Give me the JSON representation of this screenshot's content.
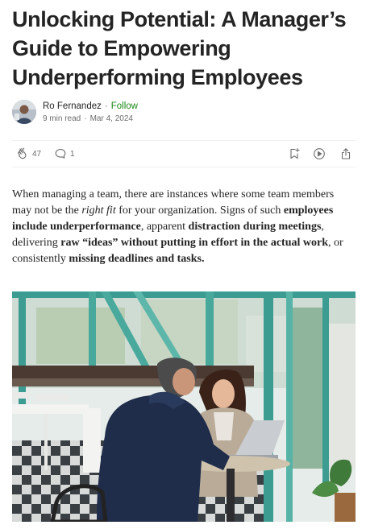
{
  "article": {
    "title": "Unlocking Potential: A Manager’s Guide to Empowering Underperforming Employees"
  },
  "byline": {
    "author": "Ro Fernandez",
    "separator": "·",
    "follow_label": "Follow",
    "read_time": "9 min read",
    "date": "Mar 4, 2024"
  },
  "actions": {
    "claps": "47",
    "responses": "1"
  },
  "body": {
    "p1": "When managing a team, there are instances where some team members may not be the ",
    "p2": "right fit",
    "p3": " for your organization. Signs of such ",
    "p4": "employees include underperformance",
    "p5": ", apparent ",
    "p6": "distraction during meetings",
    "p7": ", delivering ",
    "p8": "raw “ideas” without putting in effort in the actual work",
    "p9": ", or consistently ",
    "p10": "missing deadlines and tasks.",
    "p11": ""
  },
  "colors": {
    "text": "#242424",
    "muted": "#6b6b6b",
    "follow": "#1a8917"
  }
}
